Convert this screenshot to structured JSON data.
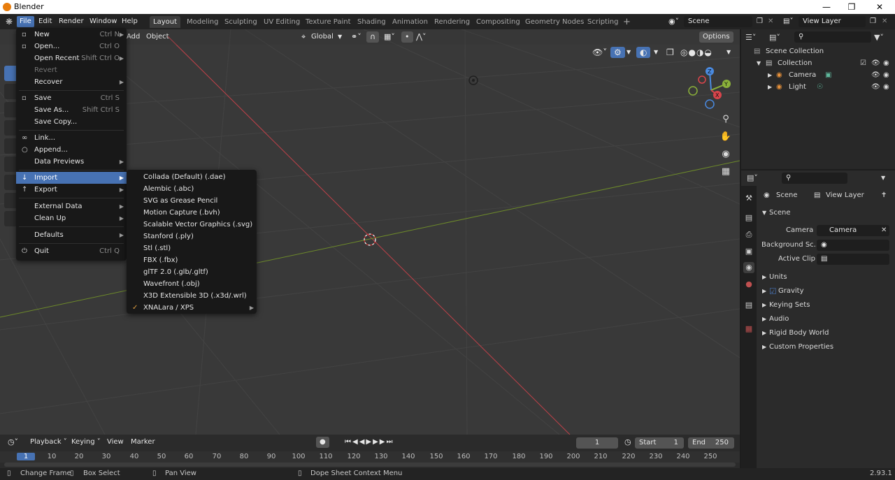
{
  "window": {
    "title": "Blender",
    "version": "2.93.1"
  },
  "menubar": [
    {
      "label": "File"
    },
    {
      "label": "Edit"
    },
    {
      "label": "Render"
    },
    {
      "label": "Window"
    },
    {
      "label": "Help"
    }
  ],
  "workspaces": [
    "Layout",
    "Modeling",
    "Sculpting",
    "UV Editing",
    "Texture Paint",
    "Shading",
    "Animation",
    "Rendering",
    "Compositing",
    "Geometry Nodes",
    "Scripting"
  ],
  "scene_field": "Scene",
  "view_layer_field": "View Layer",
  "viewport_header": {
    "add": "Add",
    "object": "Object",
    "transform_orientation": "Global",
    "options": "Options"
  },
  "file_menu": {
    "new": {
      "label": "New",
      "shortcut": "Ctrl N"
    },
    "open": {
      "label": "Open...",
      "shortcut": "Ctrl O"
    },
    "open_recent": {
      "label": "Open Recent",
      "shortcut": "Shift Ctrl O"
    },
    "revert": {
      "label": "Revert"
    },
    "recover": {
      "label": "Recover"
    },
    "save": {
      "label": "Save",
      "shortcut": "Ctrl S"
    },
    "save_as": {
      "label": "Save As...",
      "shortcut": "Shift Ctrl S"
    },
    "save_copy": {
      "label": "Save Copy..."
    },
    "link": {
      "label": "Link..."
    },
    "append": {
      "label": "Append..."
    },
    "data_previews": {
      "label": "Data Previews"
    },
    "import": {
      "label": "Import"
    },
    "export": {
      "label": "Export"
    },
    "external_data": {
      "label": "External Data"
    },
    "clean_up": {
      "label": "Clean Up"
    },
    "defaults": {
      "label": "Defaults"
    },
    "quit": {
      "label": "Quit",
      "shortcut": "Ctrl Q"
    }
  },
  "import_menu": [
    "Collada (Default) (.dae)",
    "Alembic (.abc)",
    "SVG as Grease Pencil",
    "Motion Capture (.bvh)",
    "Scalable Vector Graphics (.svg)",
    "Stanford (.ply)",
    "Stl (.stl)",
    "FBX (.fbx)",
    "glTF 2.0 (.glb/.gltf)",
    "Wavefront (.obj)",
    "X3D Extensible 3D (.x3d/.wrl)",
    "XNALara / XPS"
  ],
  "outliner": {
    "scene_collection": "Scene Collection",
    "collection": "Collection",
    "camera": "Camera",
    "light": "Light"
  },
  "properties": {
    "tab_scene": "Scene",
    "tab_view_layer": "View Layer",
    "panel_scene": "Scene",
    "camera_label": "Camera",
    "camera_value": "Camera",
    "background_label": "Background Sc...",
    "active_clip_label": "Active Clip",
    "panels": [
      "Units",
      "Gravity",
      "Keying Sets",
      "Audio",
      "Rigid Body World",
      "Custom Properties"
    ]
  },
  "timeline": {
    "playback": "Playback",
    "keying": "Keying",
    "view": "View",
    "marker": "Marker",
    "current_frame": "1",
    "start_label": "Start",
    "start": "1",
    "end_label": "End",
    "end": "250",
    "ruler": [
      "1",
      "10",
      "20",
      "30",
      "40",
      "50",
      "60",
      "70",
      "80",
      "90",
      "100",
      "110",
      "120",
      "130",
      "140",
      "150",
      "160",
      "170",
      "180",
      "190",
      "200",
      "210",
      "220",
      "230",
      "240",
      "250"
    ]
  },
  "statusbar": {
    "change_frame": "Change Frame",
    "box_select": "Box Select",
    "pan_view": "Pan View",
    "context_menu": "Dope Sheet Context Menu"
  },
  "colors": {
    "accent": "#4772b3",
    "x_axis": "#d9444b",
    "y_axis": "#8bb13a",
    "z_axis": "#4a8ae0"
  }
}
